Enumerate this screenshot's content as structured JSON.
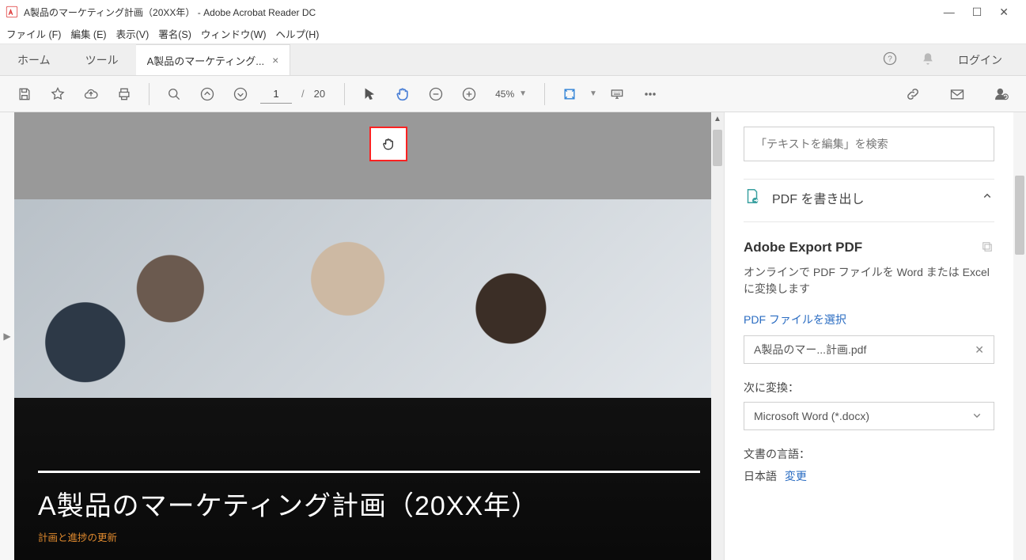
{
  "window": {
    "title": "A製品のマーケティング計画（20XX年） - Adobe Acrobat Reader DC"
  },
  "menu": {
    "file": "ファイル (F)",
    "edit": "編集 (E)",
    "view": "表示(V)",
    "sign": "署名(S)",
    "window": "ウィンドウ(W)",
    "help": "ヘルプ(H)"
  },
  "tabs": {
    "home": "ホーム",
    "tools": "ツール",
    "doc": "A製品のマーケティング..."
  },
  "topright": {
    "login": "ログイン"
  },
  "toolbar": {
    "page_current": "1",
    "page_sep": "/",
    "page_total": "20",
    "zoom": "45%"
  },
  "document": {
    "title": "A製品のマーケティング計画（20XX年）",
    "subtitle": "計画と進捗の更新"
  },
  "panel": {
    "search_placeholder": "「テキストを編集」を検索",
    "export_header": "PDF を書き出し",
    "export_title": "Adobe Export PDF",
    "export_desc": "オンラインで PDF ファイルを Word または Excel に変換します",
    "select_file_link": "PDF ファイルを選択",
    "selected_file": "A製品のマー...計画.pdf",
    "convert_to_label": "次に変換：",
    "convert_to_value": "Microsoft Word (*.docx)",
    "doc_lang_label": "文書の言語：",
    "doc_lang_value": "日本語",
    "change_link": "変更"
  }
}
